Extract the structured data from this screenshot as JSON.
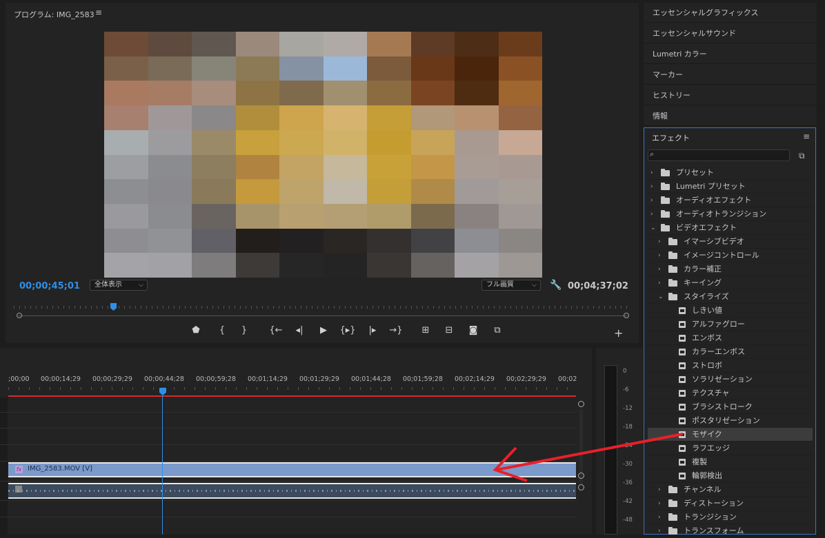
{
  "program": {
    "title": "プログラム: IMG_2583",
    "menu_icon": "≡",
    "timecode_current": "00;00;45;01",
    "zoom": "全体表示",
    "quality": "フル画質",
    "timecode_duration": "00;04;37;02",
    "mosaic_colors": [
      [
        "#6e4b36",
        "#5e4a3e",
        "#5f5750",
        "#9b8a7c",
        "#a8a6a0",
        "#b0aaa6",
        "#a57a52",
        "#5e3b24",
        "#4e2d17",
        "#6a3c1c"
      ],
      [
        "#7a6048",
        "#7a6b58",
        "#878478",
        "#8c7a56",
        "#8592a4",
        "#9bb8d8",
        "#7c5a3c",
        "#693818",
        "#4a250c",
        "#8a5224"
      ],
      [
        "#a97a60",
        "#a67c64",
        "#a88c7c",
        "#8e7444",
        "#7f6a4c",
        "#a09070",
        "#8a6c40",
        "#7a4422",
        "#4e2c12",
        "#a06630"
      ],
      [
        "#a78070",
        "#a09898",
        "#8a8888",
        "#b08e3c",
        "#cea44c",
        "#d6b470",
        "#c69e38",
        "#b09878",
        "#b89270",
        "#946442"
      ],
      [
        "#a8aeb0",
        "#9c9c9e",
        "#9a8a68",
        "#c8a03c",
        "#cca850",
        "#d0b268",
        "#c49c30",
        "#c8a458",
        "#a89a90",
        "#c6a894"
      ],
      [
        "#9c9ea2",
        "#8a8c90",
        "#8c7e5e",
        "#b08440",
        "#c4a464",
        "#c6b89a",
        "#c8a238",
        "#c49648",
        "#a89c94",
        "#a89a92"
      ],
      [
        "#8c8e92",
        "#8a8a8e",
        "#8a7a5a",
        "#c49a3c",
        "#bea46a",
        "#c0b8a8",
        "#c49e38",
        "#b08a48",
        "#a09a98",
        "#a89e98"
      ],
      [
        "#9a9a9e",
        "#8a8c90",
        "#6a6460",
        "#a8946a",
        "#b8a070",
        "#b49e74",
        "#b09c6a",
        "#7c6a4c",
        "#8a8280",
        "#a09894"
      ],
      [
        "#8e8e92",
        "#909296",
        "#606066",
        "#221e1c",
        "#222020",
        "#2a2624",
        "#343030",
        "#424244",
        "#8c8e94",
        "#8a8684"
      ],
      [
        "#a4a4a8",
        "#a2a2a6",
        "#7e7c7c",
        "#3e3a38",
        "#262626",
        "#242424",
        "#3a3634",
        "#666260",
        "#a4a2a4",
        "#9e9894"
      ]
    ]
  },
  "timeline": {
    "ruler_labels": [
      ";00;00",
      "00;00;14;29",
      "00;00;29;29",
      "00;00;44;28",
      "00;00;59;28",
      "00;01;14;29",
      "00;01;29;29",
      "00;01;44;28",
      "00;01;59;28",
      "00;02;14;29",
      "00;02;29;29",
      "00;02"
    ],
    "video_clip_name": "IMG_2583.MOV [V]",
    "fx_badge": "fx"
  },
  "meter": {
    "labels": [
      "0",
      "-6",
      "-12",
      "-18",
      "-24",
      "-30",
      "-36",
      "-42",
      "-48"
    ]
  },
  "right_panels": [
    "エッセンシャルグラフィックス",
    "エッセンシャルサウンド",
    "Lumetri カラー",
    "マーカー",
    "ヒストリー",
    "情報"
  ],
  "effects": {
    "title": "エフェクト",
    "menu_icon": "≡",
    "tree": [
      {
        "label": "プリセット",
        "level": 0,
        "type": "folder",
        "open": false
      },
      {
        "label": "Lumetri プリセット",
        "level": 0,
        "type": "folder",
        "open": false
      },
      {
        "label": "オーディオエフェクト",
        "level": 0,
        "type": "folder",
        "open": false
      },
      {
        "label": "オーディオトランジション",
        "level": 0,
        "type": "folder",
        "open": false
      },
      {
        "label": "ビデオエフェクト",
        "level": 0,
        "type": "folder",
        "open": true
      },
      {
        "label": "イマーシブビデオ",
        "level": 1,
        "type": "folder",
        "open": false
      },
      {
        "label": "イメージコントロール",
        "level": 1,
        "type": "folder",
        "open": false
      },
      {
        "label": "カラー補正",
        "level": 1,
        "type": "folder",
        "open": false
      },
      {
        "label": "キーイング",
        "level": 1,
        "type": "folder",
        "open": false
      },
      {
        "label": "スタイライズ",
        "level": 1,
        "type": "folder",
        "open": true
      },
      {
        "label": "しきい値",
        "level": 2,
        "type": "effect"
      },
      {
        "label": "アルファグロー",
        "level": 2,
        "type": "effect"
      },
      {
        "label": "エンボス",
        "level": 2,
        "type": "effect"
      },
      {
        "label": "カラーエンボス",
        "level": 2,
        "type": "effect"
      },
      {
        "label": "ストロボ",
        "level": 2,
        "type": "effect"
      },
      {
        "label": "ソラリゼーション",
        "level": 2,
        "type": "effect"
      },
      {
        "label": "テクスチャ",
        "level": 2,
        "type": "effect"
      },
      {
        "label": "ブラシストローク",
        "level": 2,
        "type": "effect"
      },
      {
        "label": "ポスタリゼーション",
        "level": 2,
        "type": "effect"
      },
      {
        "label": "モザイク",
        "level": 2,
        "type": "effect",
        "selected": true
      },
      {
        "label": "ラフエッジ",
        "level": 2,
        "type": "effect"
      },
      {
        "label": "複製",
        "level": 2,
        "type": "effect"
      },
      {
        "label": "輪郭検出",
        "level": 2,
        "type": "effect"
      },
      {
        "label": "チャンネル",
        "level": 1,
        "type": "folder",
        "open": false
      },
      {
        "label": "ディストーション",
        "level": 1,
        "type": "folder",
        "open": false
      },
      {
        "label": "トランジション",
        "level": 1,
        "type": "folder",
        "open": false
      },
      {
        "label": "トランスフォーム",
        "level": 1,
        "type": "folder",
        "open": false
      }
    ]
  },
  "annotation_color": "#e8202a",
  "accent_color": "#2f8fe8"
}
